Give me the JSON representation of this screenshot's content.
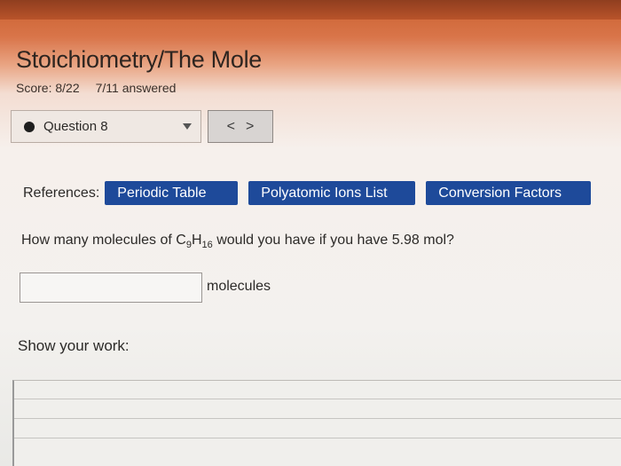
{
  "page": {
    "title": "Stoichiometry/The Mole",
    "score": "Score: 8/22",
    "answered": "7/11 answered"
  },
  "question_nav": {
    "current": "Question 8",
    "prev_label": "<",
    "next_label": ">"
  },
  "references": {
    "label": "References:",
    "buttons": [
      "Periodic Table",
      "Polyatomic Ions List",
      "Conversion Factors"
    ],
    "button_color": "#1e4a9a"
  },
  "question": {
    "prefix": "How many molecules of C",
    "sub1": "9",
    "mid": "H",
    "sub2": "16",
    "suffix": " would you have if you have 5.98 mol?"
  },
  "answer": {
    "value": "",
    "unit": "molecules"
  },
  "work": {
    "label": "Show your work:"
  }
}
